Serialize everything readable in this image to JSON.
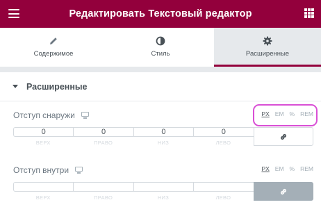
{
  "header": {
    "title": "Редактировать Текстовый редактор",
    "menu_icon": "hamburger-icon",
    "apps_icon": "grid-icon",
    "color": "#93003c"
  },
  "tabs": [
    {
      "label": "Содержимое",
      "icon": "pencil-icon",
      "active": false
    },
    {
      "label": "Стиль",
      "icon": "contrast-icon",
      "active": false
    },
    {
      "label": "Расширенные",
      "icon": "gear-icon",
      "active": true
    }
  ],
  "section": {
    "title": "Расширенные"
  },
  "margin": {
    "label": "Отступ снаружи",
    "units": [
      "PX",
      "EM",
      "%",
      "REM"
    ],
    "selected_unit": "PX",
    "values": [
      "0",
      "0",
      "0",
      "0"
    ],
    "sides": [
      "ВЕРХ",
      "ПРАВО",
      "НИЗ",
      "ЛЕВО"
    ],
    "linked": false
  },
  "padding": {
    "label": "Отступ внутри",
    "units": [
      "PX",
      "EM",
      "%",
      "REM"
    ],
    "selected_unit": "PX",
    "values": [
      "",
      "",
      "",
      ""
    ],
    "sides": [
      "ВЕРХ",
      "ПРАВО",
      "НИЗ",
      "ЛЕВО"
    ],
    "linked": true
  }
}
